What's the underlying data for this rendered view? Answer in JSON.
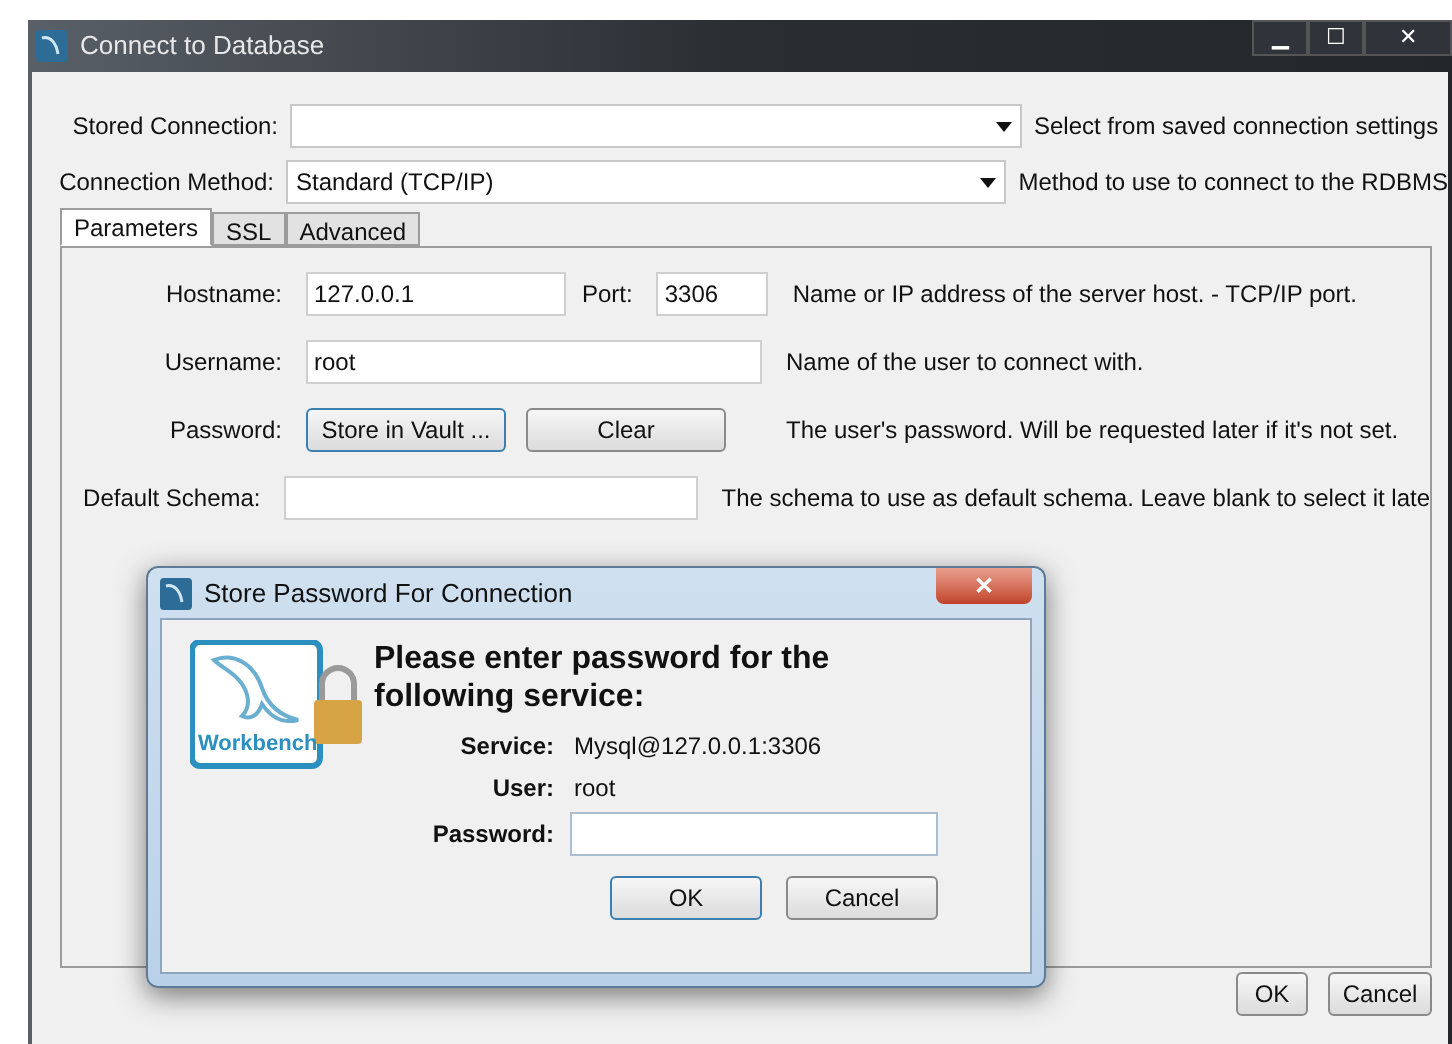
{
  "window": {
    "title": "Connect to Database",
    "controls": [
      "▁",
      "☐",
      "✕"
    ]
  },
  "top_fields": [
    {
      "label": "Stored Connection:",
      "hint": "Select from saved connection settings"
    },
    {
      "label": "Connection Method:",
      "value": "Standard (TCP/IP)",
      "hint": "Method to use to connect to the RDBMS"
    }
  ],
  "tabs": [
    {
      "label": "Parameters",
      "selected": true
    },
    {
      "label": "SSL",
      "selected": false
    },
    {
      "label": "Advanced",
      "selected": false
    }
  ],
  "parameters": {
    "hostname": {
      "label": "Hostname:",
      "value": "127.0.0.1"
    },
    "port": {
      "label": "Port:",
      "value": "3306"
    },
    "host_hint": "Name or IP address of the server host. - TCP/IP port.",
    "username": {
      "label": "Username:",
      "value": "root",
      "hint": "Name of the user to connect with."
    },
    "password": {
      "label": "Password:",
      "buttons": [
        "Store in Vault ...",
        "Clear"
      ],
      "hint": "The user's password. Will be requested later if it's not set."
    },
    "schema": {
      "label": "Default Schema:",
      "hint": "The schema to use as default schema. Leave blank to select it late"
    }
  },
  "buttons": [
    "OK",
    "Cancel"
  ],
  "dialog": {
    "title": "Store Password For Connection",
    "close": "✕",
    "logo_text": "Workbench",
    "heading": "Please enter password for the following service:",
    "service": {
      "label": "Service:",
      "value": "Mysql@127.0.0.1:3306"
    },
    "user": {
      "label": "User:",
      "value": "root"
    },
    "password": {
      "label": "Password:"
    },
    "buttons": [
      "OK",
      "Cancel"
    ]
  }
}
